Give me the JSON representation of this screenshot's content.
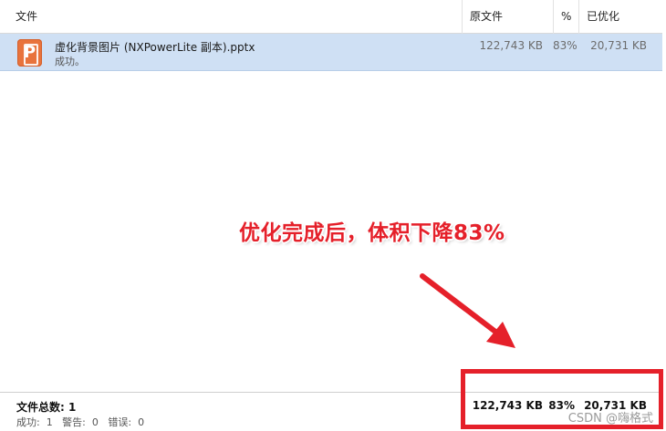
{
  "header": {
    "col_file": "文件",
    "col_original": "原文件",
    "col_percent": "%",
    "col_optimized": "已优化"
  },
  "row": {
    "icon": "powerpoint-file-icon",
    "file_name": "虚化背景图片 (NXPowerLite 副本).pptx",
    "status": "成功。",
    "original_size": "122,743 KB",
    "percent": "83%",
    "optimized_size": "20,731 KB"
  },
  "annotation": {
    "text": "优化完成后，体积下降83%",
    "color": "#e5202a"
  },
  "footer": {
    "total_label": "文件总数: 1",
    "stats": "成功:  1   警告:  0   错误:  0",
    "total_original": "122,743 KB",
    "total_percent": "83%",
    "total_optimized": "20,731 KB"
  },
  "colors": {
    "selected_row": "#cfe0f4",
    "icon": "#e8733c",
    "highlight": "#e5202a"
  },
  "watermark": "CSDN @嗨格式"
}
